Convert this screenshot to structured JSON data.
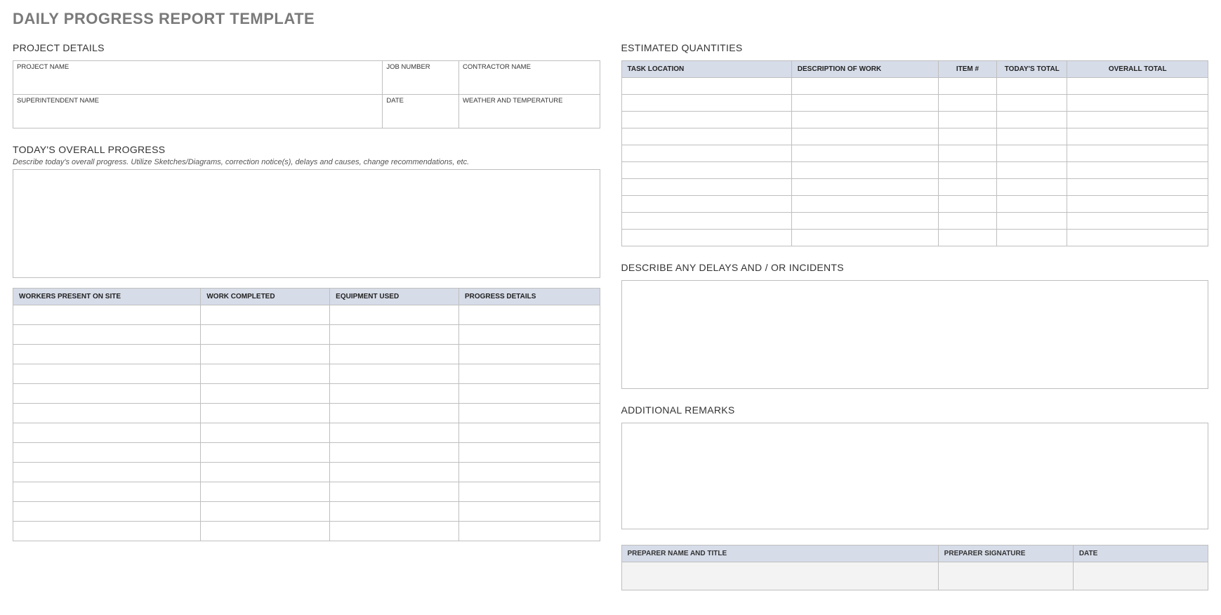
{
  "title": "DAILY PROGRESS REPORT TEMPLATE",
  "sections": {
    "project_details": {
      "title": "PROJECT DETAILS",
      "row1": {
        "project_name": "PROJECT NAME",
        "job_number": "JOB NUMBER",
        "contractor_name": "CONTRACTOR NAME"
      },
      "row2": {
        "superintendent_name": "SUPERINTENDENT NAME",
        "date": "DATE",
        "weather": "WEATHER AND TEMPERATURE"
      }
    },
    "overall_progress": {
      "title": "TODAY'S OVERALL PROGRESS",
      "hint": "Describe today's overall progress.  Utilize Sketches/Diagrams, correction notice(s), delays and causes, change recommendations, etc."
    },
    "progress_table": {
      "headers": {
        "workers": "WORKERS PRESENT ON SITE",
        "completed": "WORK COMPLETED",
        "equipment": "EQUIPMENT USED",
        "details": "PROGRESS DETAILS"
      },
      "row_count": 12
    },
    "quantities": {
      "title": "ESTIMATED QUANTITIES",
      "headers": {
        "location": "TASK LOCATION",
        "description": "DESCRIPTION OF WORK",
        "item": "ITEM #",
        "today_total": "TODAY'S TOTAL",
        "overall_total": "OVERALL TOTAL"
      },
      "row_count": 10
    },
    "delays": {
      "title": "DESCRIBE ANY DELAYS AND / OR INCIDENTS"
    },
    "remarks": {
      "title": "ADDITIONAL REMARKS"
    },
    "signature": {
      "preparer_name": "PREPARER NAME AND TITLE",
      "preparer_sig": "PREPARER SIGNATURE",
      "date": "DATE"
    }
  }
}
